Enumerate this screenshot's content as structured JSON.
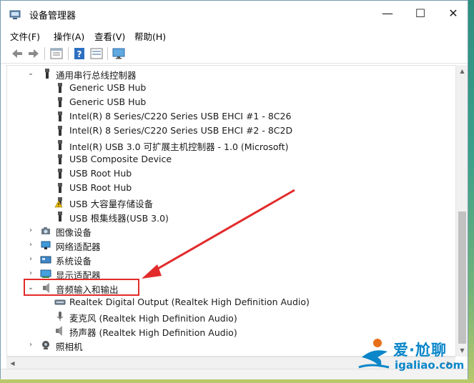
{
  "window": {
    "title": "设备管理器"
  },
  "title_buttons": {
    "minimize": "—",
    "maximize": "☐",
    "close": "✕"
  },
  "menu": [
    "文件(F)",
    "操作(A)",
    "查看(V)",
    "帮助(H)"
  ],
  "toolbar": [
    "back-arrow-icon",
    "forward-arrow-icon",
    "properties-icon",
    "list-view-icon",
    "help-icon",
    "resource-view-icon",
    "monitor-icon"
  ],
  "tree": {
    "usb_controllers": {
      "label": "通用串行总线控制器",
      "children": [
        "Generic USB Hub",
        "Generic USB Hub",
        "Intel(R) 8 Series/C220 Series USB EHCI #1 - 8C26",
        "Intel(R) 8 Series/C220 Series USB EHCI #2 - 8C2D",
        "Intel(R) USB 3.0 可扩展主机控制器 - 1.0 (Microsoft)",
        "USB Composite Device",
        "USB Root Hub",
        "USB Root Hub",
        "USB 大容量存储设备",
        "USB 根集线器(USB 3.0)"
      ]
    },
    "imaging": "图像设备",
    "network": "网络适配器",
    "system": "系统设备",
    "display": "显示适配器",
    "audio": {
      "label": "音频输入和输出",
      "children": [
        "Realtek Digital Output (Realtek High Definition Audio)",
        "麦克风 (Realtek High Definition Audio)",
        "扬声器 (Realtek High Definition Audio)"
      ]
    },
    "camera": "照相机"
  },
  "annotation": {
    "highlight_color": "#e22b2b"
  },
  "watermark": {
    "cn": "爱·尬聊",
    "en": "igaliao.com"
  },
  "colors": {
    "accent": "#0a86c9",
    "warning": "#f2c200"
  }
}
